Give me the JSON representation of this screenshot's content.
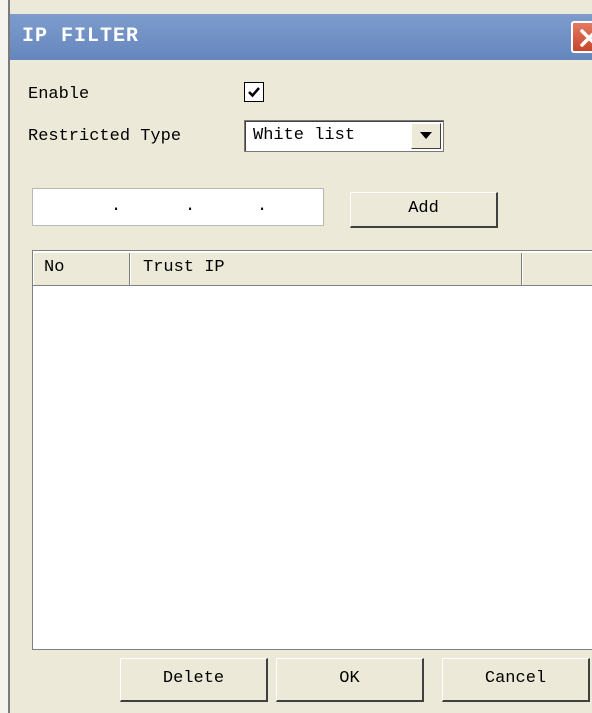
{
  "window": {
    "title": "IP FILTER",
    "close_icon": "close-icon",
    "colors": {
      "titlebar": "#6f8fc4",
      "dialog_bg": "#ece9d8",
      "close": "#c5452a"
    }
  },
  "form": {
    "enable_label": "Enable",
    "enable_checked": true,
    "restricted_type_label": "Restricted Type",
    "restricted_type_value": "White list"
  },
  "ip_entry": {
    "separators": [
      ".",
      ".",
      "."
    ],
    "add_label": "Add"
  },
  "table": {
    "columns": [
      "No",
      "Trust IP",
      ""
    ],
    "rows": []
  },
  "footer": {
    "delete_label": "Delete",
    "ok_label": "OK",
    "cancel_label": "Cancel"
  }
}
